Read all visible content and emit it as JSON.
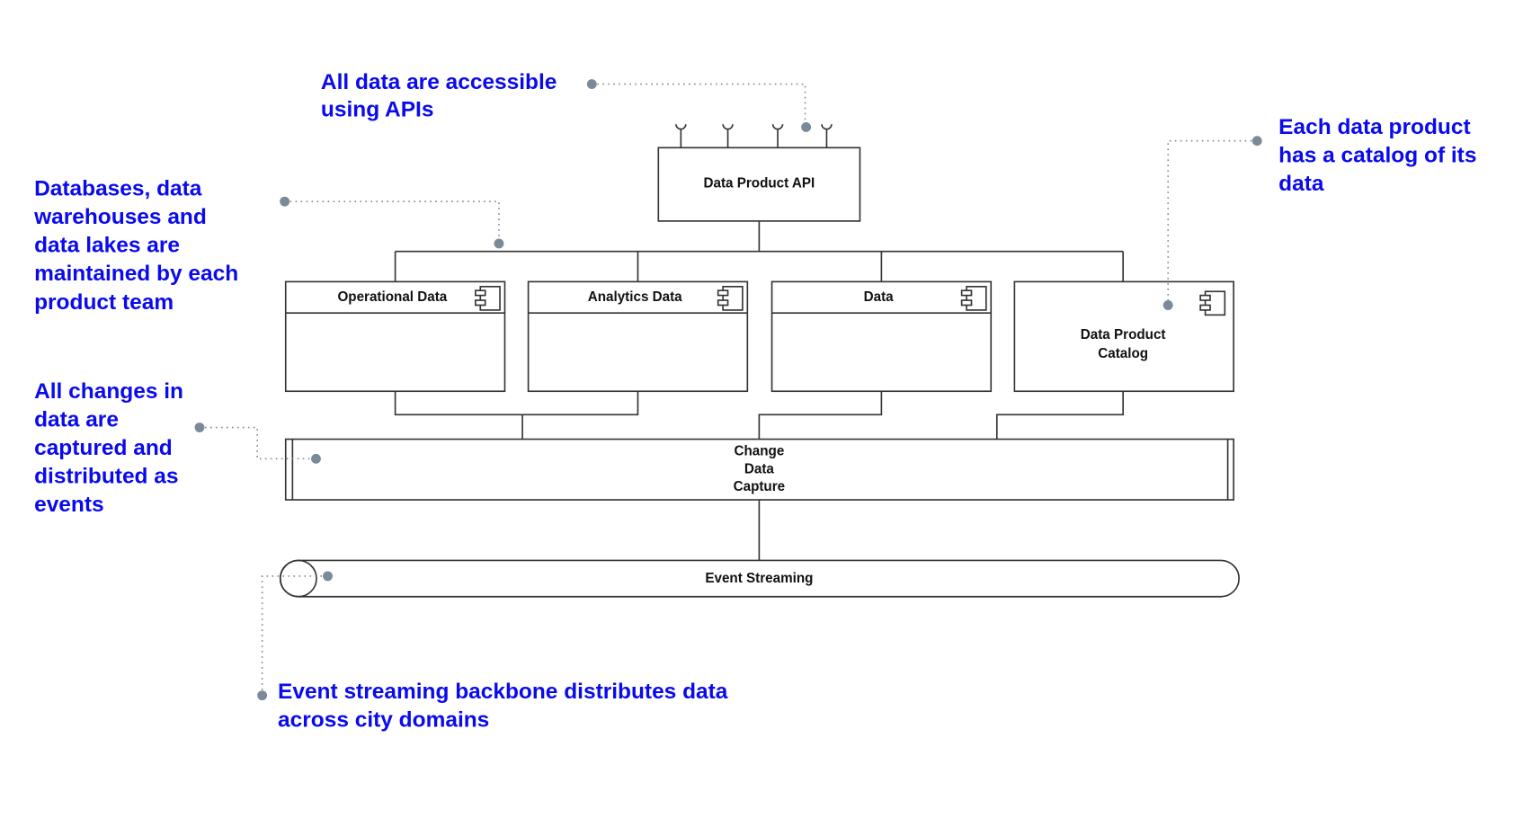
{
  "annotations": {
    "apis": [
      "All data are accessible",
      "using APIs"
    ],
    "databases": [
      "Databases, data",
      "warehouses and",
      "data lakes are",
      "maintained by each",
      "product team"
    ],
    "catalog": [
      "Each data product",
      "has a catalog of its",
      "data"
    ],
    "changes": [
      "All changes in",
      "data are",
      "captured and",
      "distributed as",
      "events"
    ],
    "streaming": [
      "Event streaming backbone distributes data",
      "across city domains"
    ]
  },
  "components": {
    "api": "Data Product API",
    "operational": "Operational Data",
    "analytics": "Analytics Data",
    "data": "Data",
    "catalog": [
      "Data Product",
      "Catalog"
    ],
    "cdc": [
      "Change",
      "Data",
      "Capture"
    ],
    "streaming": "Event Streaming"
  },
  "colors": {
    "annotation": "#0a0aee",
    "connector": "#7a8a99",
    "stroke": "#333333"
  },
  "icons": {
    "component": "uml-component-icon",
    "interface": "required-interface-socket-icon"
  }
}
